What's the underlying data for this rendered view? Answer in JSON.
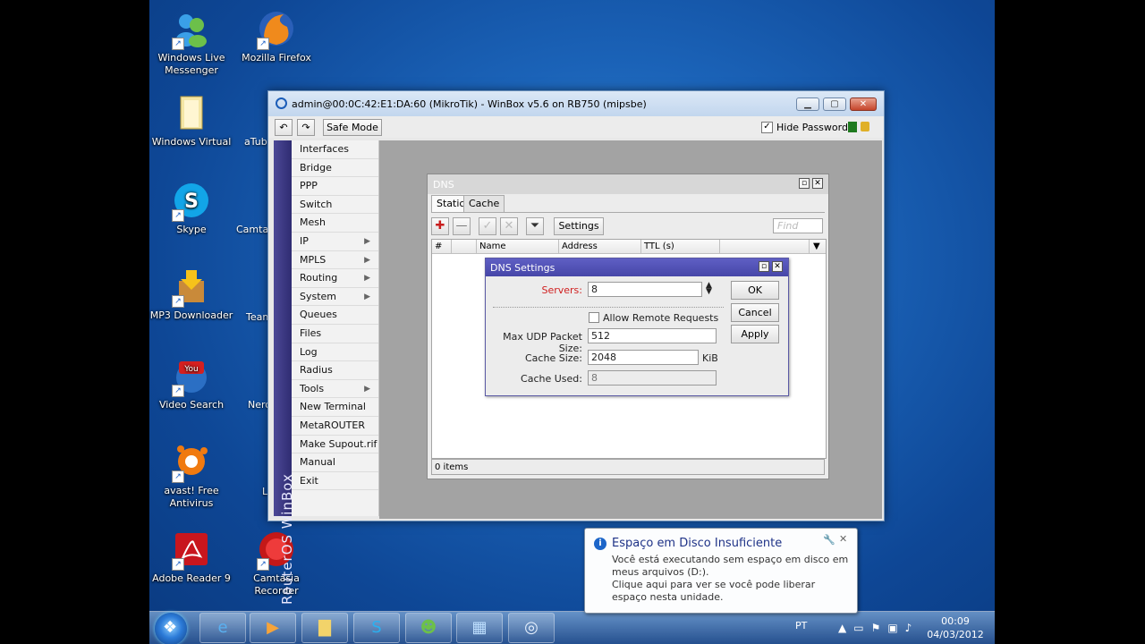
{
  "desktop": {
    "icons": [
      {
        "label": "Windows Live\nMessenger",
        "icon": "messenger-icon"
      },
      {
        "label": "Mozilla Firefox",
        "icon": "firefox-icon"
      },
      {
        "label": "Windows Virtual",
        "icon": "folder-icon"
      },
      {
        "label": "aTub",
        "icon": "atube-icon"
      },
      {
        "label": "Skype",
        "icon": "skype-icon"
      },
      {
        "label": "Camta",
        "icon": "camtasia-icon"
      },
      {
        "label": "MP3 Downloader",
        "icon": "mp3-downloader-icon"
      },
      {
        "label": "Team",
        "icon": "teamviewer-icon"
      },
      {
        "label": "Video Search",
        "icon": "youtube-icon"
      },
      {
        "label": "Nero",
        "icon": "nero-icon"
      },
      {
        "label": "avast! Free\nAntivirus",
        "icon": "avast-icon"
      },
      {
        "label": "L",
        "icon": "app-icon"
      },
      {
        "label": "Adobe Reader 9",
        "icon": "adobe-reader-icon"
      },
      {
        "label": "Camtasia\nRecorder",
        "icon": "camtasia-recorder-icon"
      }
    ]
  },
  "winbox": {
    "title": "admin@00:0C:42:E1:DA:60 (MikroTik) - WinBox v5.6 on RB750 (mipsbe)",
    "safe_mode": "Safe Mode",
    "hide_passwords": "Hide Passwords",
    "hide_passwords_checked": true,
    "side_label": "RouterOS WinBox",
    "menu": [
      {
        "label": "Interfaces",
        "submenu": false
      },
      {
        "label": "Bridge",
        "submenu": false
      },
      {
        "label": "PPP",
        "submenu": false
      },
      {
        "label": "Switch",
        "submenu": false
      },
      {
        "label": "Mesh",
        "submenu": false
      },
      {
        "label": "IP",
        "submenu": true
      },
      {
        "label": "MPLS",
        "submenu": true
      },
      {
        "label": "Routing",
        "submenu": true
      },
      {
        "label": "System",
        "submenu": true
      },
      {
        "label": "Queues",
        "submenu": false
      },
      {
        "label": "Files",
        "submenu": false
      },
      {
        "label": "Log",
        "submenu": false
      },
      {
        "label": "Radius",
        "submenu": false
      },
      {
        "label": "Tools",
        "submenu": true
      },
      {
        "label": "New Terminal",
        "submenu": false
      },
      {
        "label": "MetaROUTER",
        "submenu": false
      },
      {
        "label": "Make Supout.rif",
        "submenu": false
      },
      {
        "label": "Manual",
        "submenu": false
      },
      {
        "label": "Exit",
        "submenu": false
      }
    ]
  },
  "dns": {
    "title": "DNS",
    "tabs": [
      "Static",
      "Cache"
    ],
    "settings_button": "Settings",
    "find_placeholder": "Find",
    "columns": [
      "#",
      "Name",
      "Address",
      "TTL (s)"
    ],
    "status": "0 items"
  },
  "dns_settings": {
    "title": "DNS Settings",
    "servers_label": "Servers:",
    "servers_value": "8",
    "allow_remote_label": "Allow Remote Requests",
    "allow_remote_checked": false,
    "max_udp_label": "Max UDP Packet Size:",
    "max_udp_value": "512",
    "cache_size_label": "Cache Size:",
    "cache_size_value": "2048",
    "cache_size_unit": "KiB",
    "cache_used_label": "Cache Used:",
    "cache_used_value": "8",
    "ok": "OK",
    "cancel": "Cancel",
    "apply": "Apply"
  },
  "notification": {
    "title": "Espaço em Disco Insuficiente",
    "line1": "Você está executando sem espaço em disco em meus arquivos (D:).",
    "line2": "Clique aqui para ver se você pode liberar espaço nesta unidade."
  },
  "taskbar": {
    "language": "PT",
    "time": "00:09",
    "date": "04/03/2012"
  },
  "colors": {
    "winbox_side": "#3d3a86",
    "dns_settings_title": "#4f4fb4",
    "servers_label": "#d02020"
  }
}
